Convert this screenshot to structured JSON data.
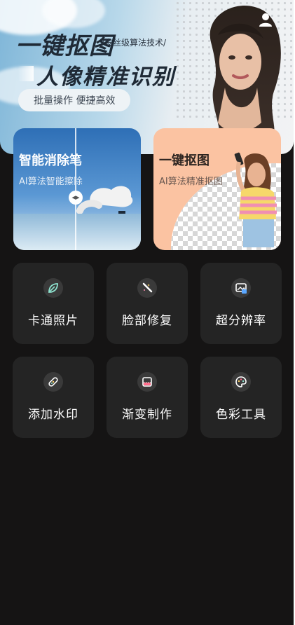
{
  "banner": {
    "title_line1": "一键抠图",
    "subtitle": "/发丝级算法技术/",
    "title_line2": "人像精准识别",
    "pill": "批量操作  便捷高效",
    "account_icon": "user-icon"
  },
  "features": [
    {
      "title": "智能消除笔",
      "desc": "AI算法智能擦除",
      "handle_glyph": "◂▸"
    },
    {
      "title": "一键抠图",
      "desc": "AI算法精准抠图"
    }
  ],
  "tools": [
    {
      "label": "卡通照片",
      "icon": "cartoon-leaf-icon"
    },
    {
      "label": "脸部修复",
      "icon": "magic-wand-icon"
    },
    {
      "label": "超分辨率",
      "icon": "hd-image-icon"
    },
    {
      "label": "添加水印",
      "icon": "bandage-icon"
    },
    {
      "label": "渐变制作",
      "icon": "gradient-icon"
    },
    {
      "label": "色彩工具",
      "icon": "palette-icon"
    }
  ],
  "colors": {
    "background": "#151414",
    "tile": "#242424",
    "cutout_card": "#fbc3a2",
    "erase_card": "#2e6fb6"
  }
}
